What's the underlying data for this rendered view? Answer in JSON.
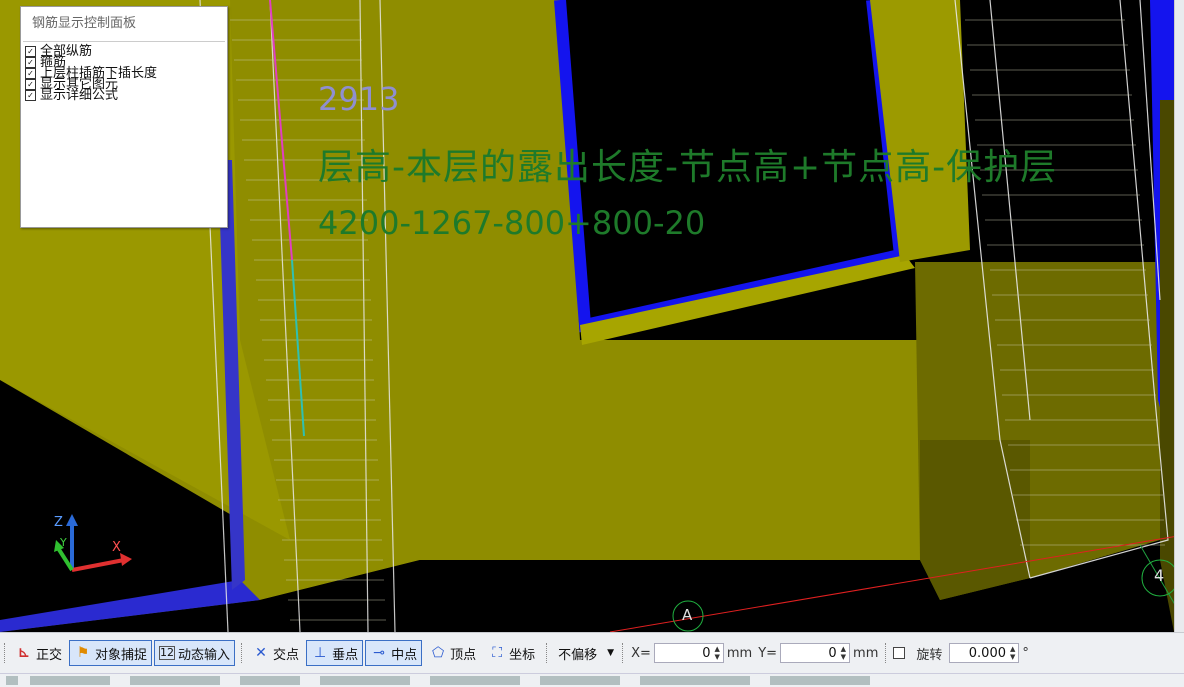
{
  "viewport": {
    "rebar_length": "2913",
    "formula_text": "层高-本层的露出长度-节点高+节点高-保护层",
    "formula_values": "4200-1267-800+800-20",
    "axis_labels": {
      "x": "X",
      "y": "Y",
      "z": "Z"
    },
    "grid_markers": [
      "A",
      "4"
    ],
    "colors": {
      "slab": "#8f8d00",
      "column": "#6d6b00",
      "beam_edge": "#0000ff",
      "formula": "#1e7a2a",
      "length": "#8f8fd0"
    }
  },
  "rebar_panel": {
    "title": "钢筋显示控制面板",
    "options": [
      {
        "label": "全部纵筋",
        "checked": true
      },
      {
        "label": "箍筋",
        "checked": true
      },
      {
        "label": "上层柱插筋下插长度",
        "checked": true
      },
      {
        "label": "显示其它图元",
        "checked": true
      },
      {
        "label": "显示详细公式",
        "checked": true
      }
    ]
  },
  "toolbar": {
    "ortho": {
      "label": "正交",
      "icon": "ortho-icon"
    },
    "snap": {
      "label": "对象捕捉",
      "icon": "snap-icon",
      "active": true
    },
    "dynamic_input": {
      "label": "动态输入",
      "icon": "dynamic-input-icon",
      "active": true
    },
    "intersection": {
      "label": "交点",
      "icon": "intersection-icon"
    },
    "perpendicular": {
      "label": "垂点",
      "icon": "perpendicular-icon",
      "active": true
    },
    "midpoint": {
      "label": "中点",
      "icon": "midpoint-icon",
      "active": true
    },
    "vertex": {
      "label": "顶点",
      "icon": "vertex-icon"
    },
    "coordinate": {
      "label": "坐标",
      "icon": "coordinate-icon"
    },
    "offset_mode": "不偏移",
    "x_label": "X=",
    "x_value": "0",
    "y_label": "Y=",
    "y_value": "0",
    "unit": "mm",
    "rotate_label": "旋转",
    "rotate_value": "0.000",
    "degree": "°"
  }
}
